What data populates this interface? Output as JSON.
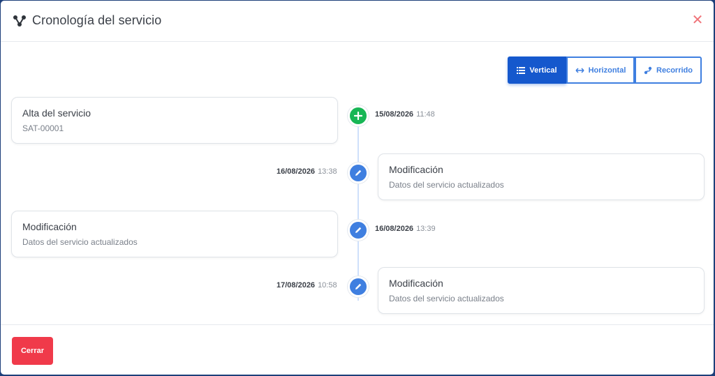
{
  "dialog": {
    "title": "Cronología del servicio",
    "title_icon": "sitemap-icon",
    "close_icon": "close-icon"
  },
  "view_switch": {
    "buttons": [
      {
        "label": "Vertical",
        "icon": "list-icon",
        "active": true
      },
      {
        "label": "Horizontal",
        "icon": "arrows-horizontal-icon",
        "active": false
      },
      {
        "label": "Recorrido",
        "icon": "route-icon",
        "active": false
      }
    ]
  },
  "timeline": [
    {
      "side": "left",
      "title": "Alta del servicio",
      "subtitle": "SAT-00001",
      "date": "15/08/2026",
      "time": "11:48",
      "icon": "plus-icon",
      "color": "#17b655"
    },
    {
      "side": "right",
      "title": "Modificación",
      "subtitle": "Datos del servicio actualizados",
      "date": "16/08/2026",
      "time": "13:38",
      "icon": "pencil-icon",
      "color": "#3f7fe0"
    },
    {
      "side": "left",
      "title": "Modificación",
      "subtitle": "Datos del servicio actualizados",
      "date": "16/08/2026",
      "time": "13:39",
      "icon": "pencil-icon",
      "color": "#3f7fe0"
    },
    {
      "side": "right",
      "title": "Modificación",
      "subtitle": "Datos del servicio actualizados",
      "date": "17/08/2026",
      "time": "10:58",
      "icon": "pencil-icon",
      "color": "#3f7fe0"
    }
  ],
  "footer": {
    "close_label": "Cerrar"
  },
  "colors": {
    "primary": "#1558cd",
    "accent": "#3f7fe0",
    "success": "#17b655",
    "danger": "#f03a4a"
  }
}
